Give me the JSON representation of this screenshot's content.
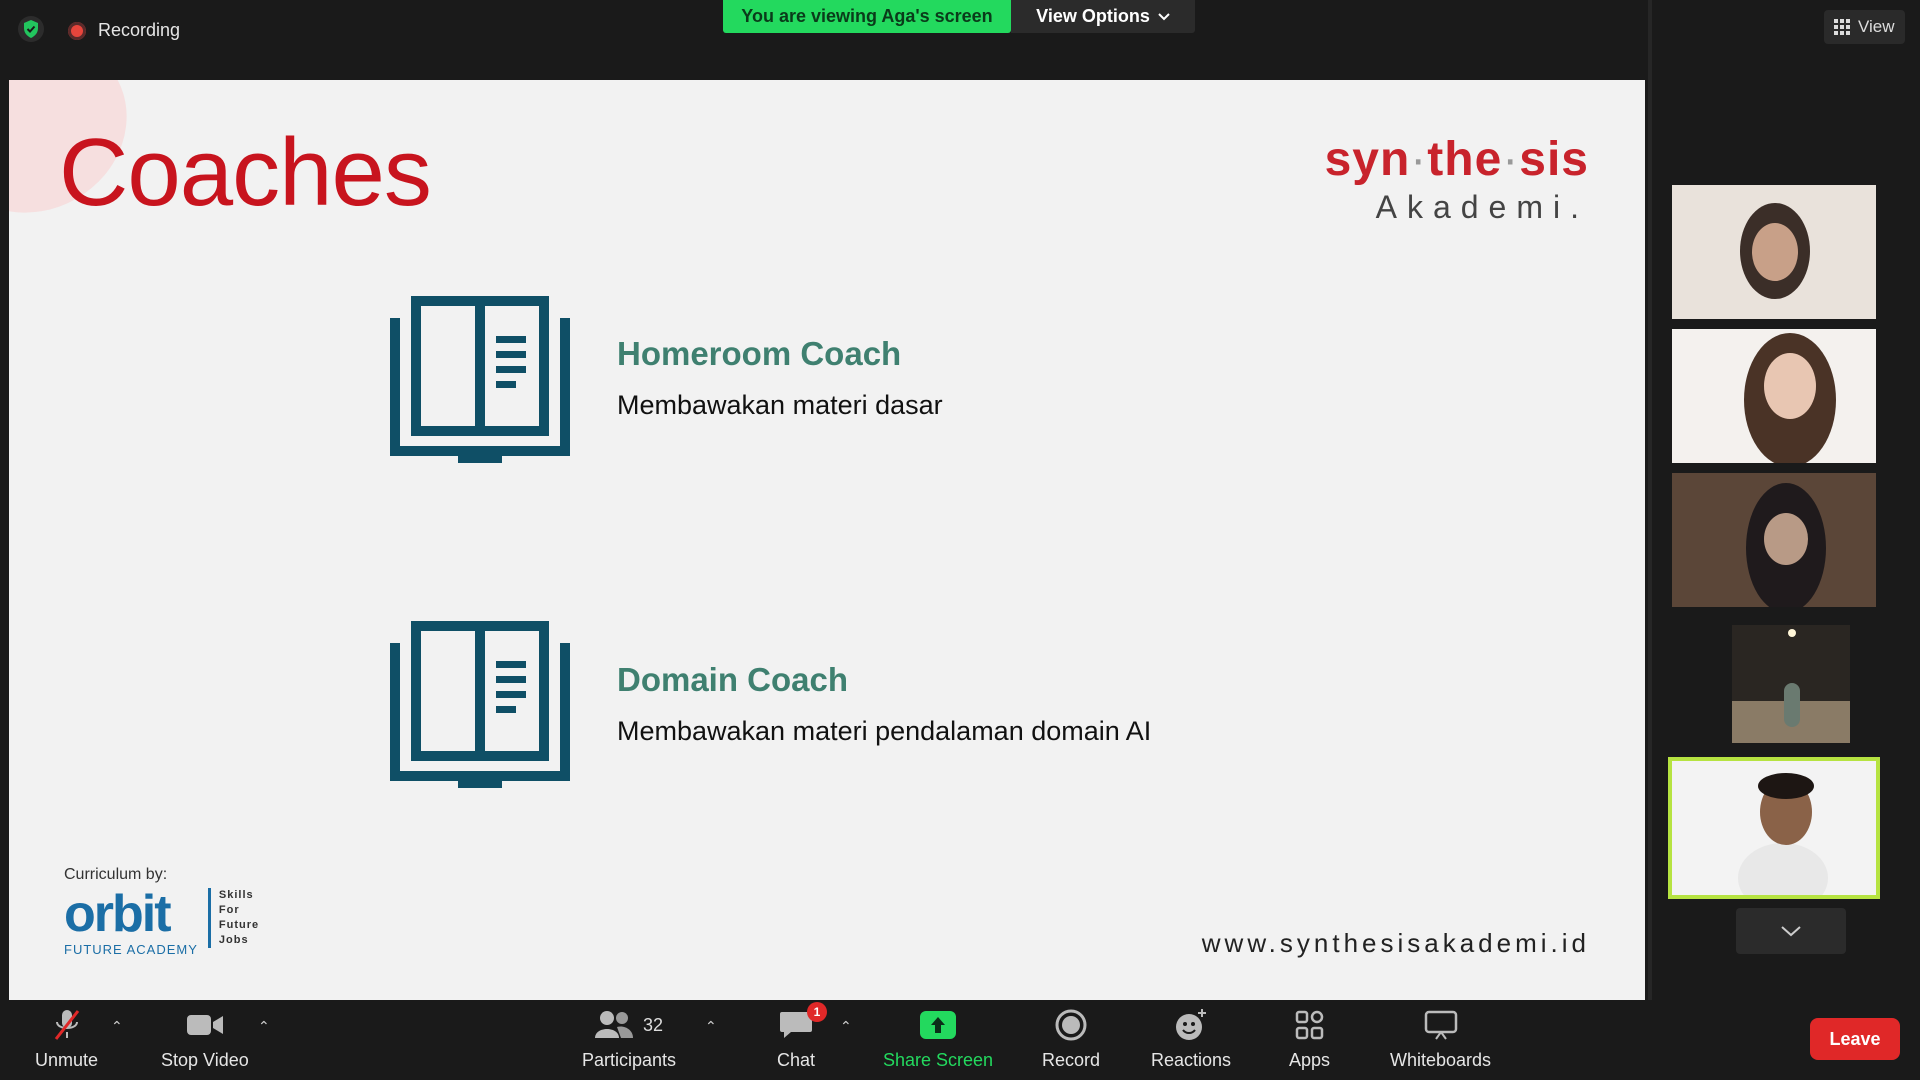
{
  "top": {
    "recording_label": "Recording",
    "viewing_banner": "You are viewing Aga's screen",
    "view_options_label": "View Options",
    "view_label": "View"
  },
  "slide": {
    "title": "Coaches",
    "brand_main": [
      "syn",
      "the",
      "sis"
    ],
    "brand_sub": "Akademi.",
    "coaches": [
      {
        "name": "Homeroom Coach",
        "desc": "Membawakan materi dasar"
      },
      {
        "name": "Domain Coach",
        "desc": "Membawakan materi pendalaman domain AI"
      }
    ],
    "curriculum_label": "Curriculum by:",
    "orbit_logo": "orbit",
    "orbit_sub": "FUTURE ACADEMY",
    "orbit_tagline": [
      "Skills",
      "For",
      "Future",
      "Jobs"
    ],
    "website": "www.synthesisakademi.id"
  },
  "toolbar": {
    "unmute": "Unmute",
    "stop_video": "Stop Video",
    "participants": "Participants",
    "participants_count": "32",
    "chat": "Chat",
    "chat_badge": "1",
    "share_screen": "Share Screen",
    "record": "Record",
    "reactions": "Reactions",
    "apps": "Apps",
    "whiteboards": "Whiteboards",
    "leave": "Leave"
  },
  "colors": {
    "accent_green": "#23d95e",
    "slide_title_red": "#c8141e",
    "coach_teal": "#3f8070",
    "book_icon": "#0f4f66",
    "leave_red": "#e02828",
    "active_speaker_border": "#b6e341"
  }
}
